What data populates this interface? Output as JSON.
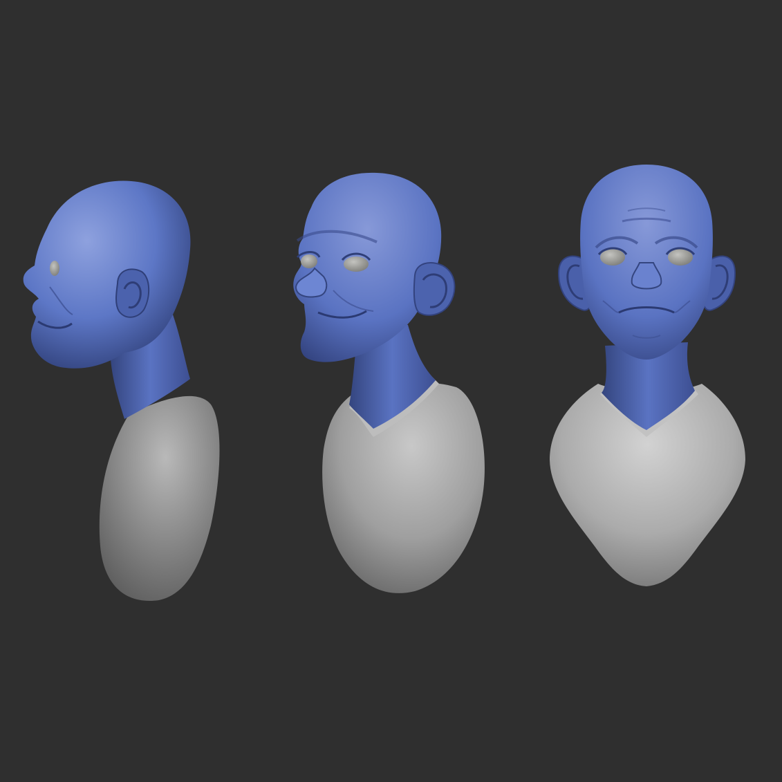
{
  "canvas": {
    "background": "#2f2f2f"
  },
  "palette": {
    "skin": "#5d77c6",
    "skin_light": "#8ea1de",
    "skin_dark": "#2f3f78",
    "shirt": "#a8a8a8",
    "shirt_light": "#cfcfcf",
    "shirt_dark": "#5f5f5f",
    "eye": "#9a9a96"
  },
  "views": [
    {
      "id": "side",
      "label": ""
    },
    {
      "id": "three-quarter",
      "label": ""
    },
    {
      "id": "front",
      "label": ""
    }
  ]
}
